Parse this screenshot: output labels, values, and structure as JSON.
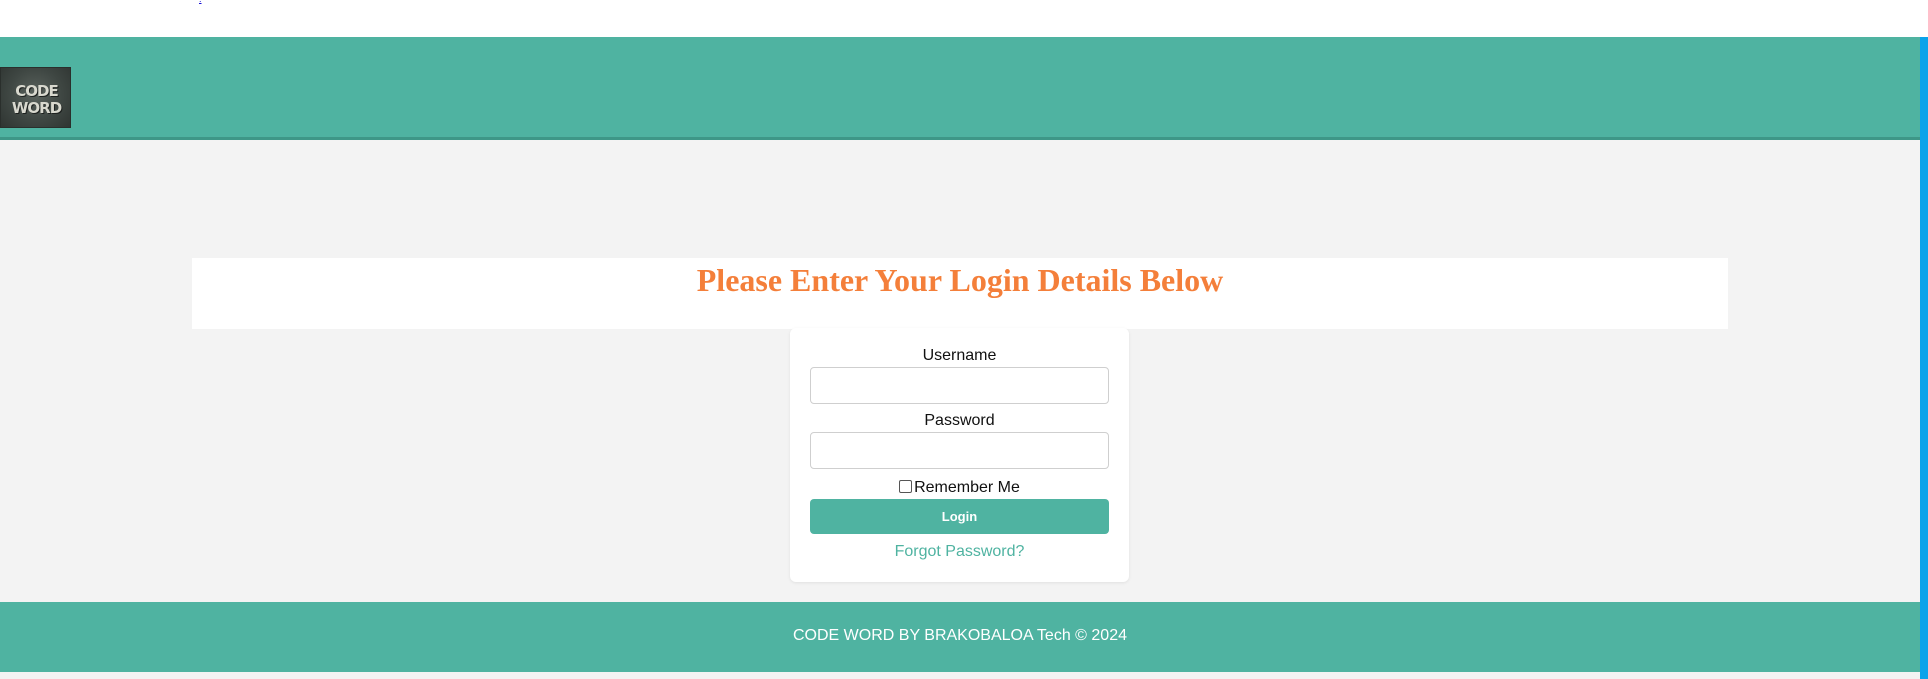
{
  "top_link": {
    "text": "."
  },
  "header": {
    "logo": {
      "line1": "CODE",
      "line2": "WORD"
    }
  },
  "main": {
    "title": "Please Enter Your Login Details Below"
  },
  "login_form": {
    "username_label": "Username",
    "username_value": "",
    "password_label": "Password",
    "password_value": "",
    "remember_label": "Remember Me",
    "remember_checked": false,
    "login_button": "Login",
    "forgot_link": "Forgot Password?"
  },
  "footer": {
    "text": "CODE WORD BY BRAKOBALOA Tech © 2024"
  },
  "colors": {
    "header_bg": "#4fb3a1",
    "title_color": "#f47f3a",
    "page_bg": "#f3f3f3",
    "scroll_edge": "#0aa3ea"
  }
}
